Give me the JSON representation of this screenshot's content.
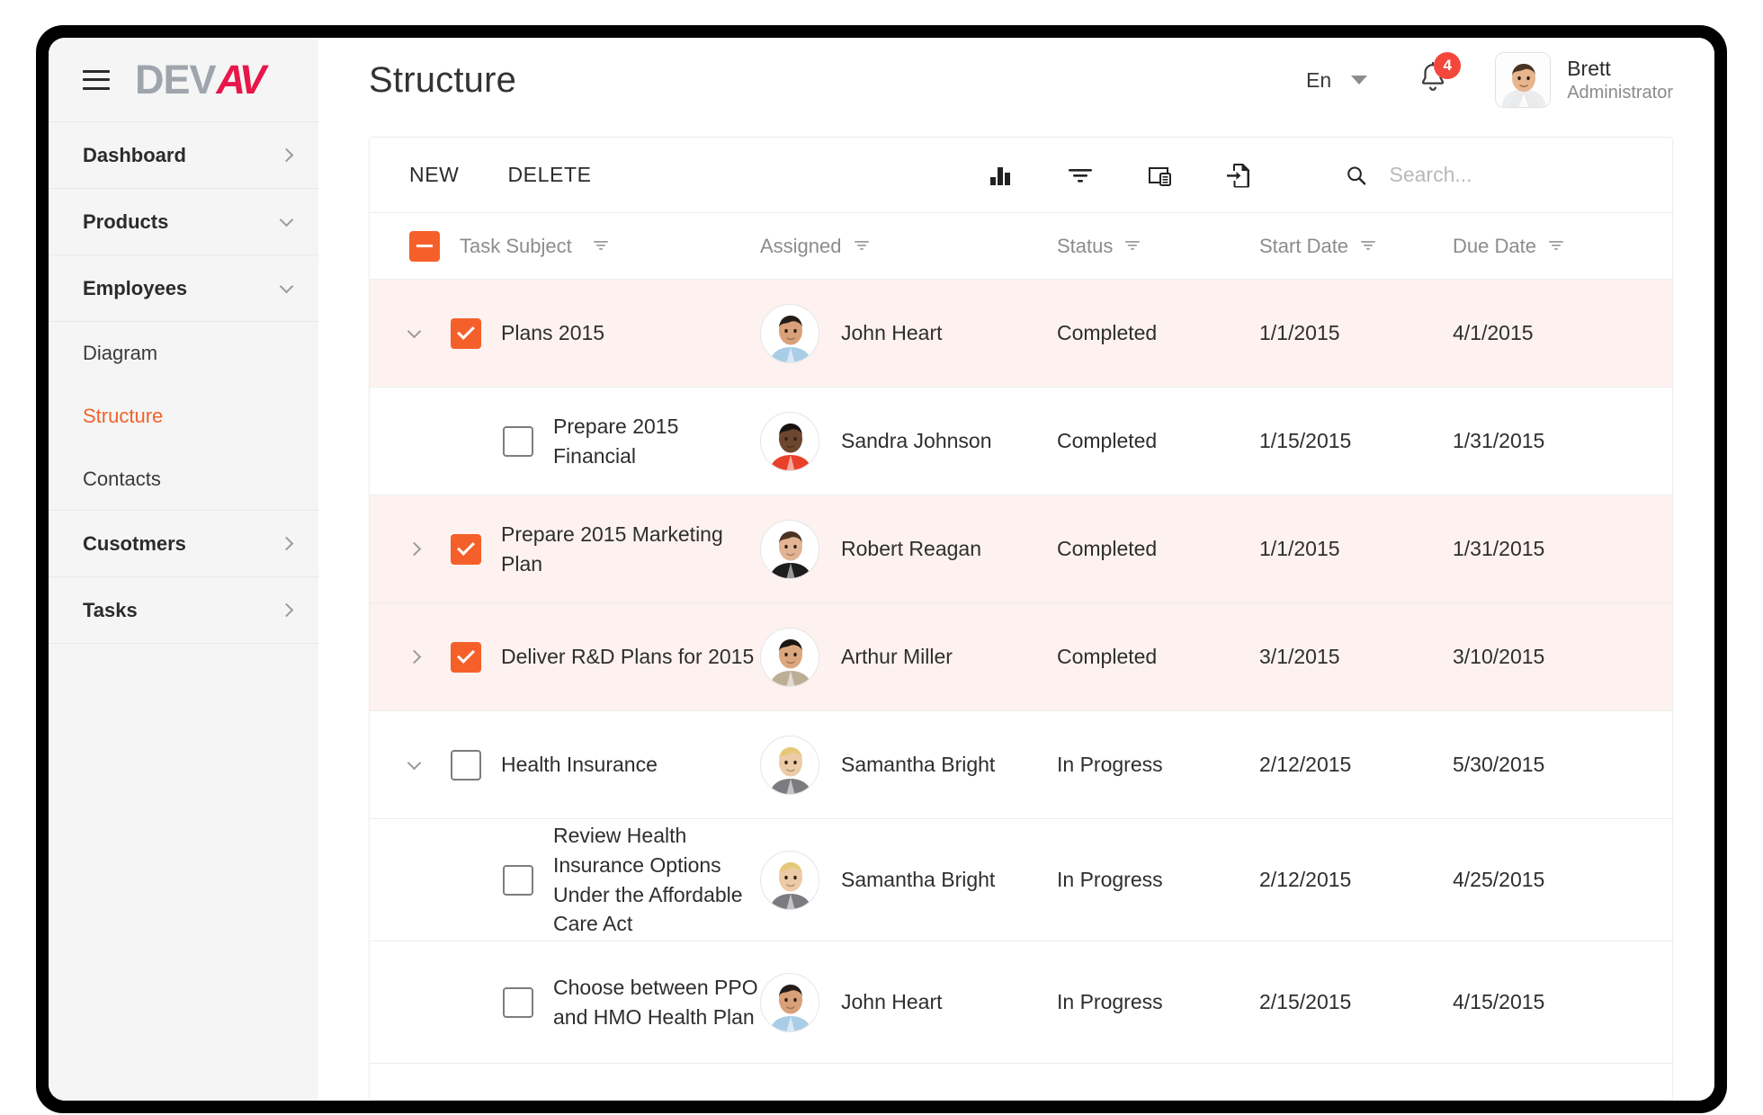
{
  "brand": {
    "logo_primary": "DEV",
    "logo_accent": "AV",
    "accent_color": "#e8174a",
    "active_color": "#f2622a",
    "checkbox_color": "#f5602a",
    "badge_color": "#f4473c"
  },
  "sidebar": {
    "menu_icon": "hamburger-icon",
    "items": [
      {
        "label": "Dashboard",
        "type": "group",
        "chevron": "right",
        "active": false
      },
      {
        "label": "Products",
        "type": "group",
        "chevron": "down",
        "active": false
      },
      {
        "label": "Employees",
        "type": "group",
        "chevron": "down",
        "active": false
      },
      {
        "label": "Diagram",
        "type": "child",
        "chevron": "",
        "active": false
      },
      {
        "label": "Structure",
        "type": "child",
        "chevron": "",
        "active": true
      },
      {
        "label": "Contacts",
        "type": "child",
        "chevron": "",
        "active": false
      },
      {
        "label": "Cusotmers",
        "type": "group",
        "chevron": "right",
        "active": false
      },
      {
        "label": "Tasks",
        "type": "group",
        "chevron": "right",
        "active": false
      }
    ]
  },
  "header": {
    "title": "Structure",
    "language": "En",
    "language_caret": "chevron-down-icon",
    "notifications_icon": "bell-icon",
    "notifications_count": "4",
    "user_name": "Brett",
    "user_role": "Administrator",
    "avatar": "avatar"
  },
  "toolbar": {
    "new_label": "NEW",
    "delete_label": "DELETE",
    "icons": [
      "chart-icon",
      "filter-icon",
      "column-chooser-icon",
      "export-icon"
    ],
    "search_icon": "search-icon",
    "search_value": "",
    "search_placeholder": "Search..."
  },
  "grid": {
    "select_all_state": "indeterminate",
    "columns": [
      {
        "label": "Task Subject",
        "filter_icon": "filter-icon"
      },
      {
        "label": "Assigned",
        "filter_icon": "filter-icon"
      },
      {
        "label": "Status",
        "filter_icon": "filter-icon"
      },
      {
        "label": "Start Date",
        "filter_icon": "filter-icon"
      },
      {
        "label": "Due Date",
        "filter_icon": "filter-icon"
      }
    ],
    "rows": [
      {
        "subject": "Plans 2015",
        "assigned": "John Heart",
        "status": "Completed",
        "start_date": "1/1/2015",
        "due_date": "4/1/2015",
        "checked": true,
        "expander": "down",
        "level": 1,
        "highlighted": true,
        "avatar_skin": "#d9a07a",
        "avatar_hair": "#241c17",
        "avatar_shirt": "#a9cde6"
      },
      {
        "subject": "Prepare 2015 Financial",
        "assigned": "Sandra Johnson",
        "status": "Completed",
        "start_date": "1/15/2015",
        "due_date": "1/31/2015",
        "checked": false,
        "expander": "none",
        "level": 2,
        "highlighted": false,
        "avatar_skin": "#6d4630",
        "avatar_hair": "#171210",
        "avatar_shirt": "#e8412a"
      },
      {
        "subject": "Prepare 2015 Marketing Plan",
        "assigned": "Robert Reagan",
        "status": "Completed",
        "start_date": "1/1/2015",
        "due_date": "1/31/2015",
        "checked": true,
        "expander": "right",
        "level": 1,
        "highlighted": true,
        "avatar_skin": "#e2b394",
        "avatar_hair": "#4a3322",
        "avatar_shirt": "#1d1d1d"
      },
      {
        "subject": "Deliver R&D Plans for 2015",
        "assigned": "Arthur Miller",
        "status": "Completed",
        "start_date": "3/1/2015",
        "due_date": "3/10/2015",
        "checked": true,
        "expander": "right",
        "level": 1,
        "highlighted": true,
        "avatar_skin": "#dca77f",
        "avatar_hair": "#1d1510",
        "avatar_shirt": "#bdae96"
      },
      {
        "subject": "Health Insurance",
        "assigned": "Samantha Bright",
        "status": "In Progress",
        "start_date": "2/12/2015",
        "due_date": "5/30/2015",
        "checked": false,
        "expander": "down",
        "level": 1,
        "highlighted": false,
        "avatar_skin": "#eccba7",
        "avatar_hair": "#e6c878",
        "avatar_shirt": "#7c7c80"
      },
      {
        "subject": "Review Health Insurance Options Under the Affordable Care Act",
        "assigned": "Samantha Bright",
        "status": "In Progress",
        "start_date": "2/12/2015",
        "due_date": "4/25/2015",
        "checked": false,
        "expander": "none",
        "level": 2,
        "highlighted": false,
        "avatar_skin": "#eccba7",
        "avatar_hair": "#e6c878",
        "avatar_shirt": "#7c7c80"
      },
      {
        "subject": "Choose between PPO and HMO Health Plan",
        "assigned": "John Heart",
        "status": "In Progress",
        "start_date": "2/15/2015",
        "due_date": "4/15/2015",
        "checked": false,
        "expander": "none",
        "level": 2,
        "highlighted": false,
        "avatar_skin": "#d9a07a",
        "avatar_hair": "#241c17",
        "avatar_shirt": "#a9cde6"
      }
    ]
  }
}
